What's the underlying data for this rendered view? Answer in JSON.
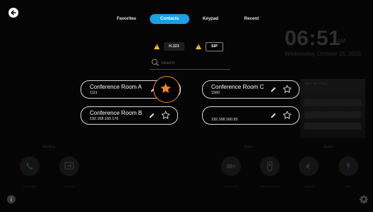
{
  "tabs": [
    {
      "label": "Favorites"
    },
    {
      "label": "Contacts"
    },
    {
      "label": "Keypad"
    },
    {
      "label": "Recent"
    }
  ],
  "active_tab": "Contacts",
  "protocols": [
    {
      "label": "H.323",
      "warning": true,
      "selected": false
    },
    {
      "label": "SIP",
      "warning": true,
      "selected": true
    }
  ],
  "search": {
    "placeholder": "Search",
    "value": ""
  },
  "contacts": [
    {
      "name": "Conference Room A",
      "number": "1111",
      "favorite": true
    },
    {
      "name": "Conference Room C",
      "number": "1560",
      "favorite": false
    },
    {
      "name": "Conference Room B",
      "number": "192.168.160.176",
      "favorite": false
    },
    {
      "name": "",
      "number": "192.168.160.93",
      "favorite": false
    }
  ],
  "background": {
    "time": "06:51",
    "ampm": "AM",
    "date": "Wednesday, October 15, 2025",
    "upcoming_label": "Next Up Today",
    "sections": {
      "meeting": "Meeting",
      "video": "Video",
      "audio": "Audio"
    },
    "buttons": {
      "place_call": "Place Call",
      "content": "Content",
      "camera_off": "Camera Off",
      "remote": "Remote Control",
      "volume": "Volume",
      "mute": "Mute"
    }
  },
  "icons": {
    "back": "back-arrow-icon",
    "info": "info-icon",
    "settings": "gear-icon",
    "search": "search-icon",
    "edit": "pencil-icon",
    "favorite": "star-icon",
    "warning": "warning-icon"
  },
  "colors": {
    "accent": "#1aa1e8",
    "favorite": "#f08a1c",
    "warning": "#f5c518",
    "background": "#050505"
  }
}
